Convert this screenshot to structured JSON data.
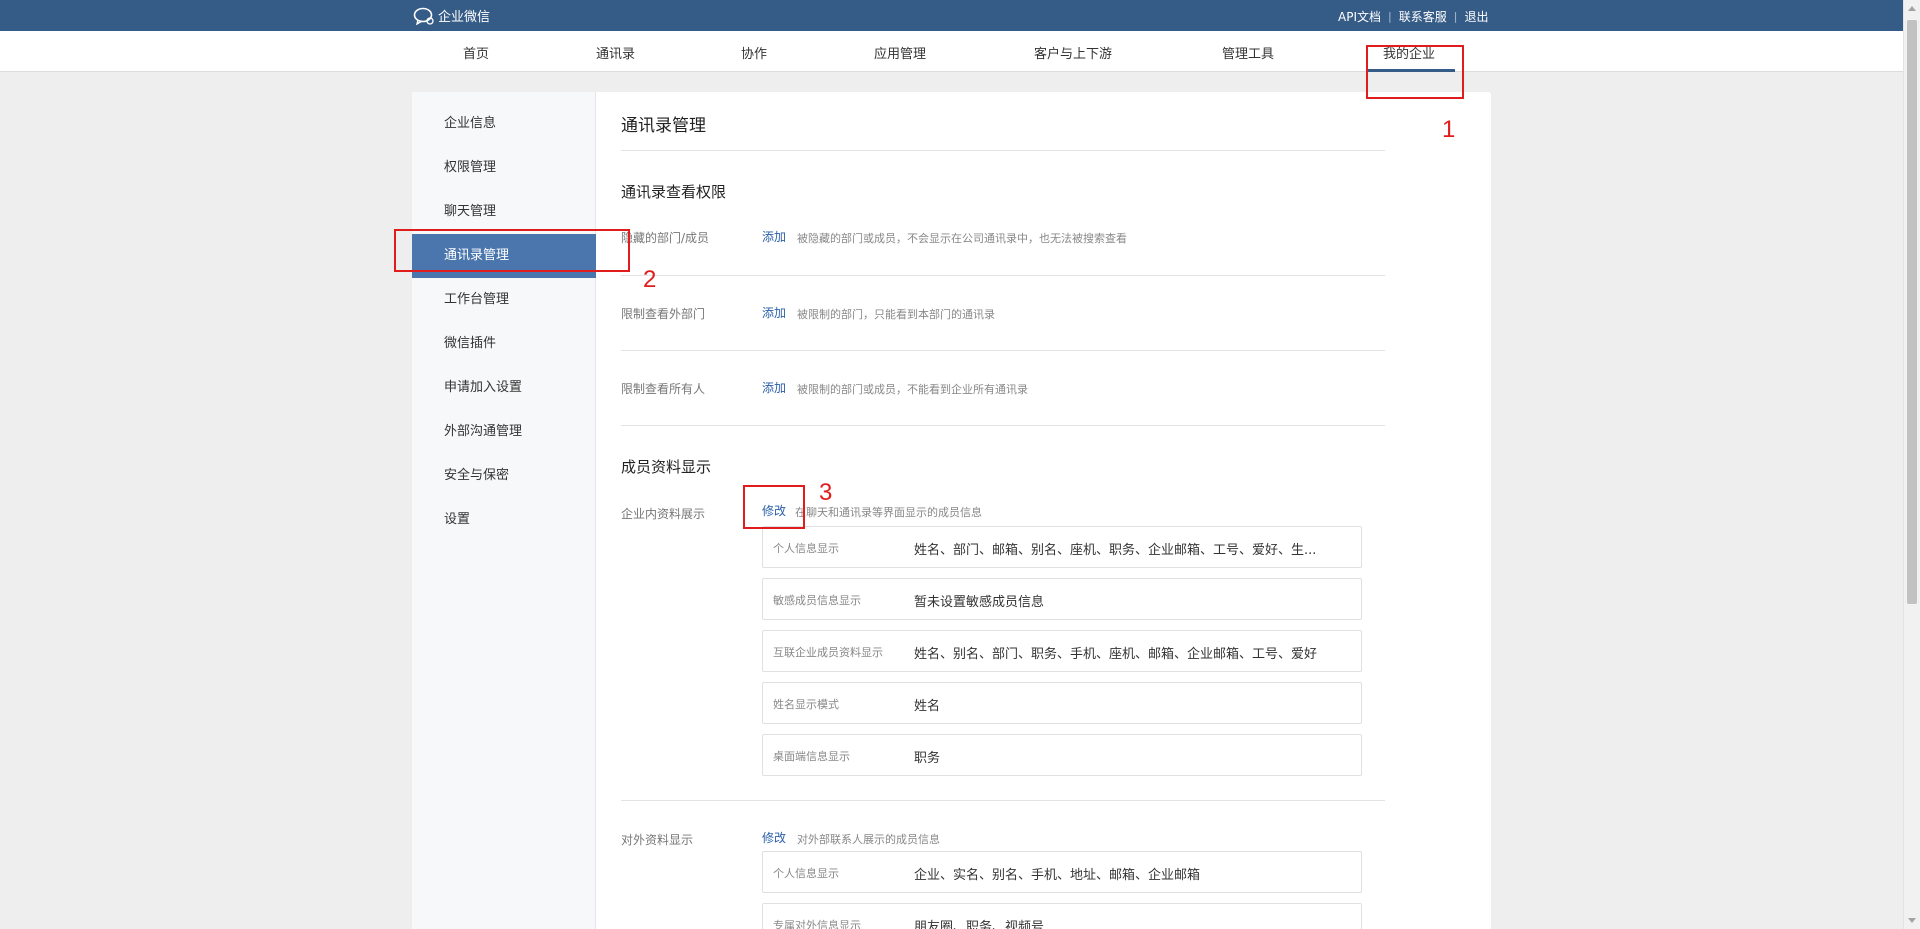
{
  "header": {
    "brand": "企业微信",
    "links": [
      "API文档",
      "联系客服",
      "退出"
    ]
  },
  "nav": {
    "items": [
      "首页",
      "通讯录",
      "协作",
      "应用管理",
      "客户与上下游",
      "管理工具",
      "我的企业"
    ],
    "active": "我的企业"
  },
  "sidebar": {
    "items": [
      "企业信息",
      "权限管理",
      "聊天管理",
      "通讯录管理",
      "工作台管理",
      "微信插件",
      "申请加入设置",
      "外部沟通管理",
      "安全与保密",
      "设置"
    ],
    "active": "通讯录管理"
  },
  "main": {
    "title": "通讯录管理",
    "view_perm": {
      "title": "通讯录查看权限",
      "rows": [
        {
          "label": "隐藏的部门/成员",
          "action": "添加",
          "desc": "被隐藏的部门或成员，不会显示在公司通讯录中，也无法被搜索查看"
        },
        {
          "label": "限制查看外部门",
          "action": "添加",
          "desc": "被限制的部门，只能看到本部门的通讯录"
        },
        {
          "label": "限制查看所有人",
          "action": "添加",
          "desc": "被限制的部门或成员，不能看到企业所有通讯录"
        }
      ]
    },
    "member_display": {
      "title": "成员资料显示",
      "internal": {
        "label": "企业内资料展示",
        "action": "修改",
        "desc": "在聊天和通讯录等界面显示的成员信息",
        "rows": [
          {
            "key": "个人信息显示",
            "value": "姓名、部门、邮箱、别名、座机、职务、企业邮箱、工号、爱好、生..."
          },
          {
            "key": "敏感成员信息显示",
            "value": "暂未设置敏感成员信息"
          },
          {
            "key": "互联企业成员资料显示",
            "value": "姓名、别名、部门、职务、手机、座机、邮箱、企业邮箱、工号、爱好"
          },
          {
            "key": "姓名显示模式",
            "value": "姓名"
          },
          {
            "key": "桌面端信息显示",
            "value": "职务"
          }
        ]
      },
      "external": {
        "label": "对外资料显示",
        "action": "修改",
        "desc": "对外部联系人展示的成员信息",
        "rows": [
          {
            "key": "个人信息显示",
            "value": "企业、实名、别名、手机、地址、邮箱、企业邮箱"
          },
          {
            "key": "专属对外信息显示",
            "value": "朋友圈、职务、视频号"
          }
        ]
      }
    }
  },
  "annotations": [
    "1",
    "2",
    "3"
  ],
  "colors": {
    "topbar": "#355b87",
    "sidebar_active": "#4a76ad",
    "link": "#2b5fa8",
    "annotation": "#e01c1c"
  }
}
